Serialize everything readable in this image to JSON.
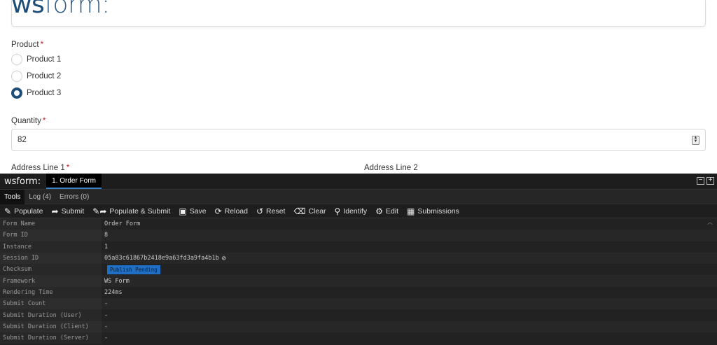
{
  "form": {
    "brand_main": "ws",
    "brand_rest": "form:",
    "product_label": "Product",
    "required_mark": "*",
    "products": [
      "Product 1",
      "Product 2",
      "Product 3"
    ],
    "selected_product": "Product 3",
    "quantity_label": "Quantity",
    "quantity_value": "82",
    "address1_label": "Address Line 1",
    "address2_label": "Address Line 2"
  },
  "panel": {
    "brand": "wsform:",
    "form_tab": "1. Order Form",
    "subtabs": [
      "Tools",
      "Log (4)",
      "Errors (0)"
    ],
    "tools": [
      {
        "label": "Populate",
        "icon": "edit-icon"
      },
      {
        "label": "Submit",
        "icon": "share-arrow-icon"
      },
      {
        "label": "Populate & Submit",
        "icon": "edit-share-icon"
      },
      {
        "label": "Save",
        "icon": "save-icon"
      },
      {
        "label": "Reload",
        "icon": "reload-icon"
      },
      {
        "label": "Reset",
        "icon": "reset-icon"
      },
      {
        "label": "Clear",
        "icon": "eraser-icon"
      },
      {
        "label": "Identify",
        "icon": "search-icon"
      },
      {
        "label": "Edit",
        "icon": "gear-icon"
      },
      {
        "label": "Submissions",
        "icon": "table-icon"
      }
    ],
    "rows": [
      {
        "key": "Form Name",
        "value": "Order Form"
      },
      {
        "key": "Form ID",
        "value": "8"
      },
      {
        "key": "Instance",
        "value": "1"
      },
      {
        "key": "Session ID",
        "value": "05a83c61867b2418e9a63fd3a9fa4b1b"
      },
      {
        "key": "Checksum",
        "value": "Publish Pending"
      },
      {
        "key": "Framework",
        "value": "WS Form"
      },
      {
        "key": "Rendering Time",
        "value": "224ms"
      },
      {
        "key": "Submit Count",
        "value": "-"
      },
      {
        "key": "Submit Duration (User)",
        "value": "-"
      },
      {
        "key": "Submit Duration (Client)",
        "value": "-"
      },
      {
        "key": "Submit Duration (Server)",
        "value": "-"
      }
    ]
  }
}
